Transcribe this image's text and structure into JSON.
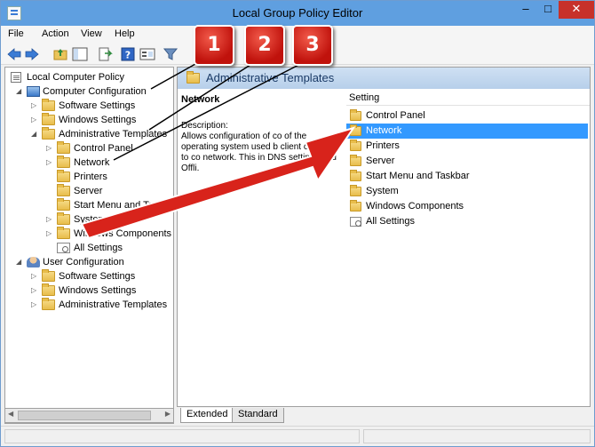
{
  "window": {
    "title": "Local Group Policy Editor",
    "controls": {
      "minimize": "–",
      "maximize": "□",
      "close": "✕"
    }
  },
  "menu": [
    "File",
    "Action",
    "View",
    "Help"
  ],
  "toolbar_icons": [
    "back-arrow-icon",
    "forward-arrow-icon",
    "up-folder-icon",
    "show-tree-icon",
    "export-list-icon",
    "help-icon",
    "properties-icon",
    "filter-icon"
  ],
  "tree": [
    {
      "label": "Local Computer Policy",
      "expander": "",
      "icon": "document-icon"
    },
    {
      "label": "Computer Configuration",
      "expander": "◢",
      "icon": "computer-icon"
    },
    {
      "label": "Software Settings",
      "expander": "▷",
      "icon": "folder-icon"
    },
    {
      "label": "Windows Settings",
      "expander": "▷",
      "icon": "folder-icon"
    },
    {
      "label": "Administrative Templates",
      "expander": "◢",
      "icon": "folder-icon"
    },
    {
      "label": "Control Panel",
      "expander": "▷",
      "icon": "folder-icon"
    },
    {
      "label": "Network",
      "expander": "▷",
      "icon": "folder-icon"
    },
    {
      "label": "Printers",
      "expander": "",
      "icon": "folder-icon"
    },
    {
      "label": "Server",
      "expander": "",
      "icon": "folder-icon"
    },
    {
      "label": "Start Menu and Taskb",
      "expander": "",
      "icon": "folder-icon"
    },
    {
      "label": "System",
      "expander": "▷",
      "icon": "folder-icon"
    },
    {
      "label": "Windows Components",
      "expander": "▷",
      "icon": "folder-icon"
    },
    {
      "label": "All Settings",
      "expander": "",
      "icon": "settings-icon"
    },
    {
      "label": "User Configuration",
      "expander": "◢",
      "icon": "user-icon"
    },
    {
      "label": "Software Settings",
      "expander": "▷",
      "icon": "folder-icon"
    },
    {
      "label": "Windows Settings",
      "expander": "▷",
      "icon": "folder-icon"
    },
    {
      "label": "Administrative Templates",
      "expander": "▷",
      "icon": "folder-icon"
    }
  ],
  "details": {
    "header": "Administrative Templates",
    "selected_title": "Network",
    "description_label": "Description:",
    "description": "Allows configuration of co of the operating system used b client computer to co network. This in DNS settings and Offli.",
    "column_header": "Setting",
    "items": [
      {
        "label": "Control Panel",
        "icon": "folder-icon",
        "selected": false
      },
      {
        "label": "Network",
        "icon": "folder-icon",
        "selected": true
      },
      {
        "label": "Printers",
        "icon": "folder-icon",
        "selected": false
      },
      {
        "label": "Server",
        "icon": "folder-icon",
        "selected": false
      },
      {
        "label": "Start Menu and Taskbar",
        "icon": "folder-icon",
        "selected": false
      },
      {
        "label": "System",
        "icon": "folder-icon",
        "selected": false
      },
      {
        "label": "Windows Components",
        "icon": "folder-icon",
        "selected": false
      },
      {
        "label": "All Settings",
        "icon": "settings-icon",
        "selected": false
      }
    ]
  },
  "tabs": [
    {
      "label": "Extended",
      "active": true
    },
    {
      "label": "Standard",
      "active": false
    }
  ],
  "callouts": [
    "1",
    "2",
    "3"
  ],
  "colors": {
    "titlebar": "#5f9fe0",
    "selection": "#3399ff",
    "close_button": "#c7312a",
    "callout_red": "#d8231b"
  }
}
